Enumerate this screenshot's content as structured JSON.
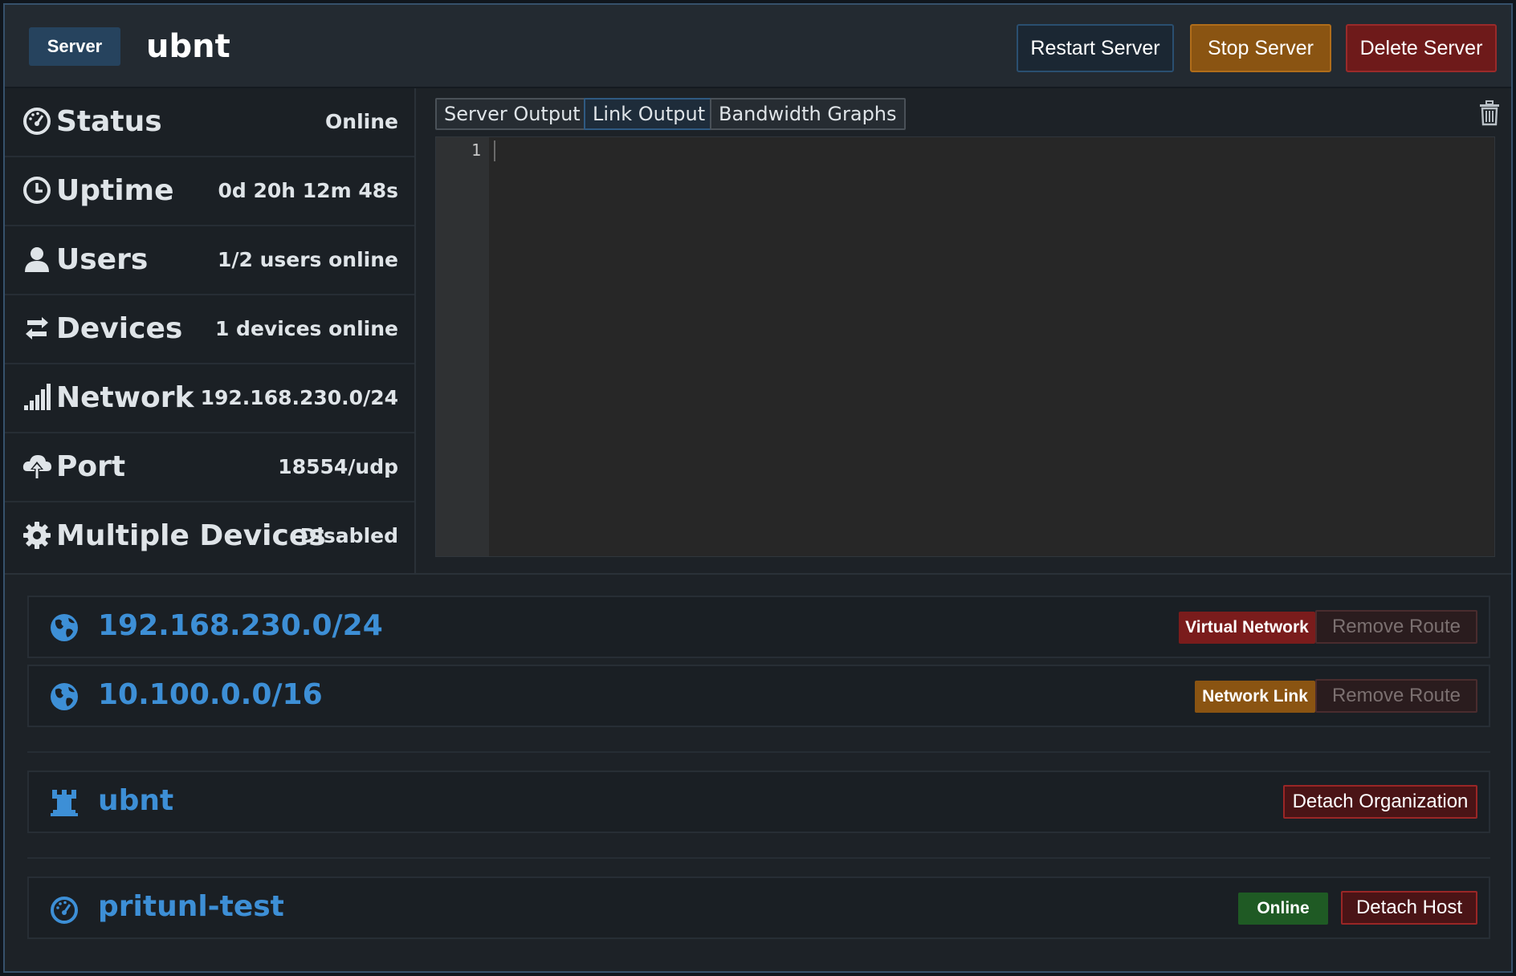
{
  "header": {
    "badge": "Server",
    "name": "ubnt",
    "buttons": {
      "restart": "Restart Server",
      "stop": "Stop Server",
      "delete": "Delete Server"
    }
  },
  "stats": [
    {
      "label": "Status",
      "value": "Online",
      "icon": "dashboard-icon"
    },
    {
      "label": "Uptime",
      "value": "0d 20h 12m 48s",
      "icon": "clock-icon"
    },
    {
      "label": "Users",
      "value": "1/2 users online",
      "icon": "user-icon"
    },
    {
      "label": "Devices",
      "value": "1 devices online",
      "icon": "transfer-icon"
    },
    {
      "label": "Network",
      "value": "192.168.230.0/24",
      "icon": "signal-icon"
    },
    {
      "label": "Port",
      "value": "18554/udp",
      "icon": "cloud-upload-icon"
    },
    {
      "label": "Multiple Devices",
      "value": "Disabled",
      "icon": "gear-icon"
    }
  ],
  "output": {
    "tabs": [
      "Server Output",
      "Link Output",
      "Bandwidth Graphs"
    ],
    "active_tab": "Link Output",
    "line_number": "1"
  },
  "routes": [
    {
      "network": "192.168.230.0/24",
      "badge": "Virtual Network",
      "action": "Remove Route"
    },
    {
      "network": "10.100.0.0/16",
      "badge": "Network Link",
      "action": "Remove Route"
    }
  ],
  "organizations": [
    {
      "name": "ubnt",
      "action": "Detach Organization"
    }
  ],
  "hosts": [
    {
      "name": "pritunl-test",
      "status": "Online",
      "action": "Detach Host"
    }
  ],
  "colors": {
    "accent_blue": "#3d8fd6",
    "virtual_network": "#7a1c1c",
    "network_link": "#8a5412",
    "online": "#1f5a24",
    "danger": "#9a2626"
  }
}
